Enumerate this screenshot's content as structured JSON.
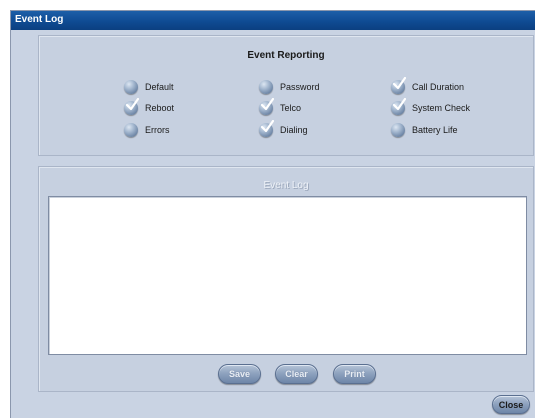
{
  "window": {
    "title": "Event Log"
  },
  "event_reporting": {
    "title": "Event Reporting",
    "options": [
      {
        "label": "Default",
        "checked": false
      },
      {
        "label": "Password",
        "checked": false
      },
      {
        "label": "Call Duration",
        "checked": true
      },
      {
        "label": "Reboot",
        "checked": true
      },
      {
        "label": "Telco",
        "checked": true
      },
      {
        "label": "System Check",
        "checked": true
      },
      {
        "label": "Errors",
        "checked": false
      },
      {
        "label": "Dialing",
        "checked": true
      },
      {
        "label": "Battery Life",
        "checked": false
      }
    ]
  },
  "event_log": {
    "title": "Event Log",
    "content": "",
    "buttons": {
      "save": "Save",
      "clear": "Clear",
      "print": "Print"
    }
  },
  "footer": {
    "close_label": "Close"
  },
  "colors": {
    "titlebar": "#0f4b93",
    "background": "#c9d3e3"
  }
}
